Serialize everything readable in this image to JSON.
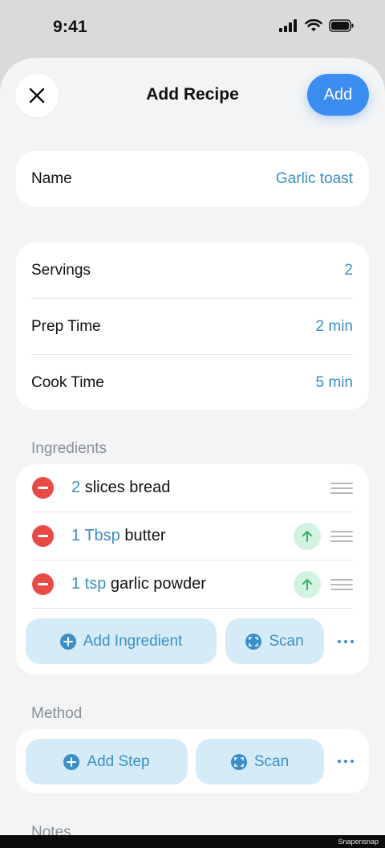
{
  "status": {
    "time": "9:41"
  },
  "header": {
    "title": "Add Recipe",
    "add_label": "Add"
  },
  "name_card": {
    "label": "Name",
    "value": "Garlic toast"
  },
  "details": [
    {
      "label": "Servings",
      "value": "2"
    },
    {
      "label": "Prep Time",
      "value": "2 min"
    },
    {
      "label": "Cook Time",
      "value": "5 min"
    }
  ],
  "ingredients": {
    "section_label": "Ingredients",
    "items": [
      {
        "qty": "2",
        "name": "slices bread"
      },
      {
        "qty": "1 Tbsp",
        "name": "butter"
      },
      {
        "qty": "1 tsp",
        "name": "garlic powder"
      }
    ],
    "add_label": "Add Ingredient",
    "scan_label": "Scan"
  },
  "method": {
    "section_label": "Method",
    "add_label": "Add Step",
    "scan_label": "Scan"
  },
  "notes": {
    "section_label": "Notes"
  },
  "watermark": "Snapensnap",
  "colors": {
    "accent": "#3b8df2",
    "value_blue": "#3b8fc6",
    "delete_red": "#e84a45",
    "pill_bg": "#d6ebf8"
  }
}
